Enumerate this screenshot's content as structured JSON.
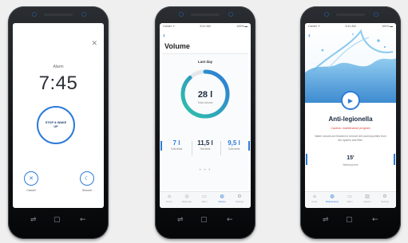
{
  "colors": {
    "accent": "#2d7bd9",
    "teal": "#2fc3a8",
    "caution": "#e23b3b",
    "phone_body": "#15171a"
  },
  "navbar_icons": [
    "recent-apps-icon",
    "home-icon",
    "back-icon"
  ],
  "navbar_glyphs": {
    "recent": "⇌",
    "home": "▢",
    "back": "←"
  },
  "screen_alarm": {
    "close_glyph": "✕",
    "label": "Alarm",
    "time": "7:45",
    "stop_button": "STOP & WAKE UP",
    "cancel_glyph": "✕",
    "cancel_label": "Cancel",
    "snooze_glyph": "☾",
    "snooze_label": "Snooze"
  },
  "screen_volume": {
    "status": {
      "left": "Carrier ᯤ",
      "center": "9:41 AM",
      "right": "100% ▬"
    },
    "back_glyph": "‹",
    "title": "Volume",
    "subtitle": "Last day",
    "total_value": "28 l",
    "total_label": "Total volume",
    "ring_fill": 0.88,
    "stats": [
      {
        "value": "7 l",
        "label": "Cold drink"
      },
      {
        "value": "11,5 l",
        "label": "Hot drink"
      },
      {
        "value": "9,5 l",
        "label": "Cold drink"
      }
    ],
    "pager": "• • •",
    "tabs": [
      {
        "icon": "⌂",
        "label": "Home"
      },
      {
        "icon": "◎",
        "label": "Dispenser"
      },
      {
        "icon": "▭",
        "label": "Alarm"
      },
      {
        "icon": "◍",
        "label": "Volume"
      },
      {
        "icon": "⚙",
        "label": "Settings"
      }
    ],
    "active_tab": 3
  },
  "screen_legionella": {
    "status": {
      "left": "Carrier ᯤ",
      "center": "9:41 AM",
      "right": "100% ▬"
    },
    "back_glyph": "‹",
    "play_glyph": "▶",
    "title": "Anti-legionella",
    "caution": "Caution: maintenance program",
    "description": "Water circuits are flushed to remove dirt and impurities from the system and filter.",
    "duration_value": "15'",
    "duration_label": "Washing time",
    "tabs": [
      {
        "icon": "⌂",
        "label": "Home"
      },
      {
        "icon": "◍",
        "label": "Maintenance"
      },
      {
        "icon": "▭",
        "label": "Alarm"
      },
      {
        "icon": "▥",
        "label": "Volume"
      },
      {
        "icon": "⚙",
        "label": "Settings"
      }
    ],
    "active_tab": 1
  }
}
